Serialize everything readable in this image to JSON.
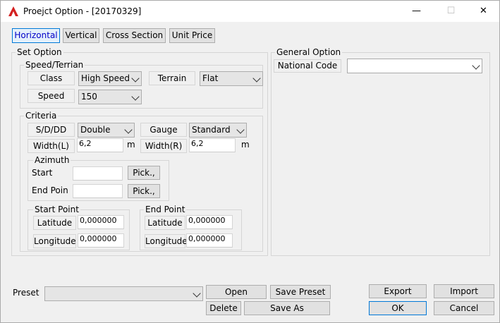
{
  "window": {
    "title": "Proejct Option - [20170329]",
    "minimize": "—",
    "maximize": "☐",
    "close": "✕"
  },
  "tabs": [
    "Horizontal",
    "Vertical",
    "Cross Section",
    "Unit Price"
  ],
  "set_option": {
    "label": "Set Option",
    "speed_terrian": {
      "label": "Speed/Terrian",
      "class_label": "Class",
      "class_value": "High Speed",
      "terrain_label": "Terrain",
      "terrain_value": "Flat",
      "speed_label": "Speed",
      "speed_value": "150"
    },
    "criteria": {
      "label": "Criteria",
      "sdd_label": "S/D/DD",
      "sdd_value": "Double",
      "gauge_label": "Gauge",
      "gauge_value": "Standard",
      "width_l_label": "Width(L)",
      "width_l_value": "6,2",
      "width_r_label": "Width(R)",
      "width_r_value": "6,2",
      "unit": "m",
      "azimuth": {
        "label": "Azimuth",
        "start_label": "Start Poir",
        "end_label": "End Poin",
        "pick_label": "Pick.,"
      },
      "start_point": {
        "label": "Start Point",
        "lat_label": "Latitude",
        "lat_value": "0,000000",
        "lon_label": "Longitude",
        "lon_value": "0,000000"
      },
      "end_point": {
        "label": "End Point",
        "lat_label": "Latitude",
        "lat_value": "0,000000",
        "lon_label": "Longitude",
        "lon_value": "0,000000"
      }
    }
  },
  "general_option": {
    "label": "General Option",
    "national_code_label": "National Code",
    "national_code_value": ""
  },
  "footer": {
    "preset_label": "Preset",
    "preset_value": "",
    "open": "Open",
    "save_preset": "Save Preset",
    "delete": "Delete",
    "save_as": "Save As",
    "export": "Export",
    "import": "Import",
    "ok": "OK",
    "cancel": "Cancel"
  }
}
